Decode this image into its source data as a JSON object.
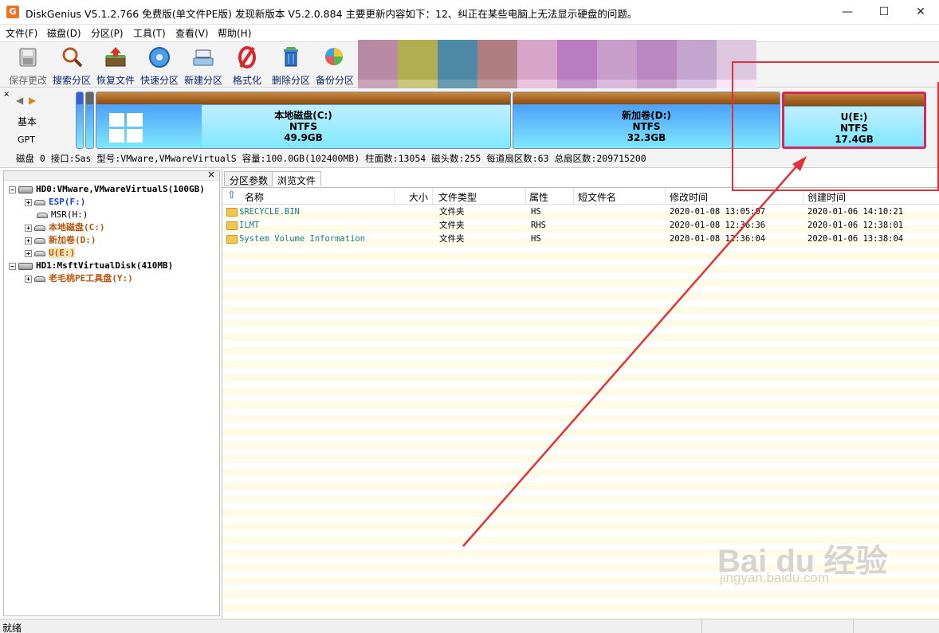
{
  "window": {
    "title": "DiskGenius V5.1.2.766 免费版(单文件PE版)    发现新版本 V5.2.0.884 主要更新内容如下：12、纠正在某些电脑上无法显示硬盘的问题。",
    "app_icon": "G",
    "minimize_glyph": "—",
    "maximize_glyph": "☐",
    "close_glyph": "✕"
  },
  "menu": [
    "文件(F)",
    "磁盘(D)",
    "分区(P)",
    "工具(T)",
    "查看(V)",
    "帮助(H)"
  ],
  "toolbar": [
    {
      "label": "保存更改",
      "icon": "save-icon"
    },
    {
      "label": "搜索分区",
      "icon": "search-icon"
    },
    {
      "label": "恢复文件",
      "icon": "recover-icon"
    },
    {
      "label": "快速分区",
      "icon": "quick-partition-icon"
    },
    {
      "label": "新建分区",
      "icon": "new-partition-icon"
    },
    {
      "label": "格式化",
      "icon": "format-icon"
    },
    {
      "label": "删除分区",
      "icon": "delete-icon"
    },
    {
      "label": "备份分区",
      "icon": "backup-icon"
    }
  ],
  "mosaic_colors": [
    "#b98aa3",
    "#b3ad52",
    "#4d88a4",
    "#b07e80",
    "#d7a5c9",
    "#b97cc0",
    "#c69ec9",
    "#b988c1",
    "#c5a5cf",
    "#ddc7de"
  ],
  "diskmap": {
    "nav_left": "◀",
    "nav_right": "▶",
    "type": "基本",
    "table": "GPT",
    "partitions": [
      {
        "name": "本地磁盘(C:)",
        "fs": "NTFS",
        "size": "49.9GB"
      },
      {
        "name": "新加卷(D:)",
        "fs": "NTFS",
        "size": "32.3GB"
      },
      {
        "name": "U(E:)",
        "fs": "NTFS",
        "size": "17.4GB"
      }
    ],
    "info": "磁盘 0  接口:Sas   型号:VMware,VMwareVirtualS   容量:100.0GB(102400MB)   柱面数:13054   磁头数:255   每道扇区数:63   总扇区数:209715200"
  },
  "tree": {
    "close": "×",
    "items": [
      {
        "label": "HD0:VMware,VMwareVirtualS(100GB)",
        "color": "#000"
      },
      {
        "label": "ESP(F:)",
        "color": "#1a3fd0"
      },
      {
        "label": "MSR(H:)",
        "color": "#000"
      },
      {
        "label": "本地磁盘(C:)",
        "color": "#b7540a"
      },
      {
        "label": "新加卷(D:)",
        "color": "#b7540a"
      },
      {
        "label": "U(E:)",
        "color": "#b7540a"
      },
      {
        "label": "HD1:MsftVirtualDisk(410MB)",
        "color": "#000"
      },
      {
        "label": "老毛桃PE工具盘(Y:)",
        "color": "#b7540a"
      }
    ]
  },
  "tabs": [
    "分区参数",
    "浏览文件"
  ],
  "columns": [
    "名称",
    "大小",
    "文件类型",
    "属性",
    "短文件名",
    "修改时间",
    "创建时间"
  ],
  "files": [
    {
      "name": "$RECYCLE.BIN",
      "size": "",
      "type": "文件夹",
      "attr": "HS",
      "short": "",
      "modified": "2020-01-08 13:05:07",
      "created": "2020-01-06 14:10:21"
    },
    {
      "name": "ILMT",
      "size": "",
      "type": "文件夹",
      "attr": "RHS",
      "short": "",
      "modified": "2020-01-08 12:36:36",
      "created": "2020-01-06 12:38:01"
    },
    {
      "name": "System Volume Information",
      "size": "",
      "type": "文件夹",
      "attr": "HS",
      "short": "",
      "modified": "2020-01-08 12:36:04",
      "created": "2020-01-06 13:38:04"
    }
  ],
  "status": "就绪",
  "watermark": "Bai du 经验",
  "watermark_url": "jingyan.baidu.com",
  "accent": "#e0323a"
}
